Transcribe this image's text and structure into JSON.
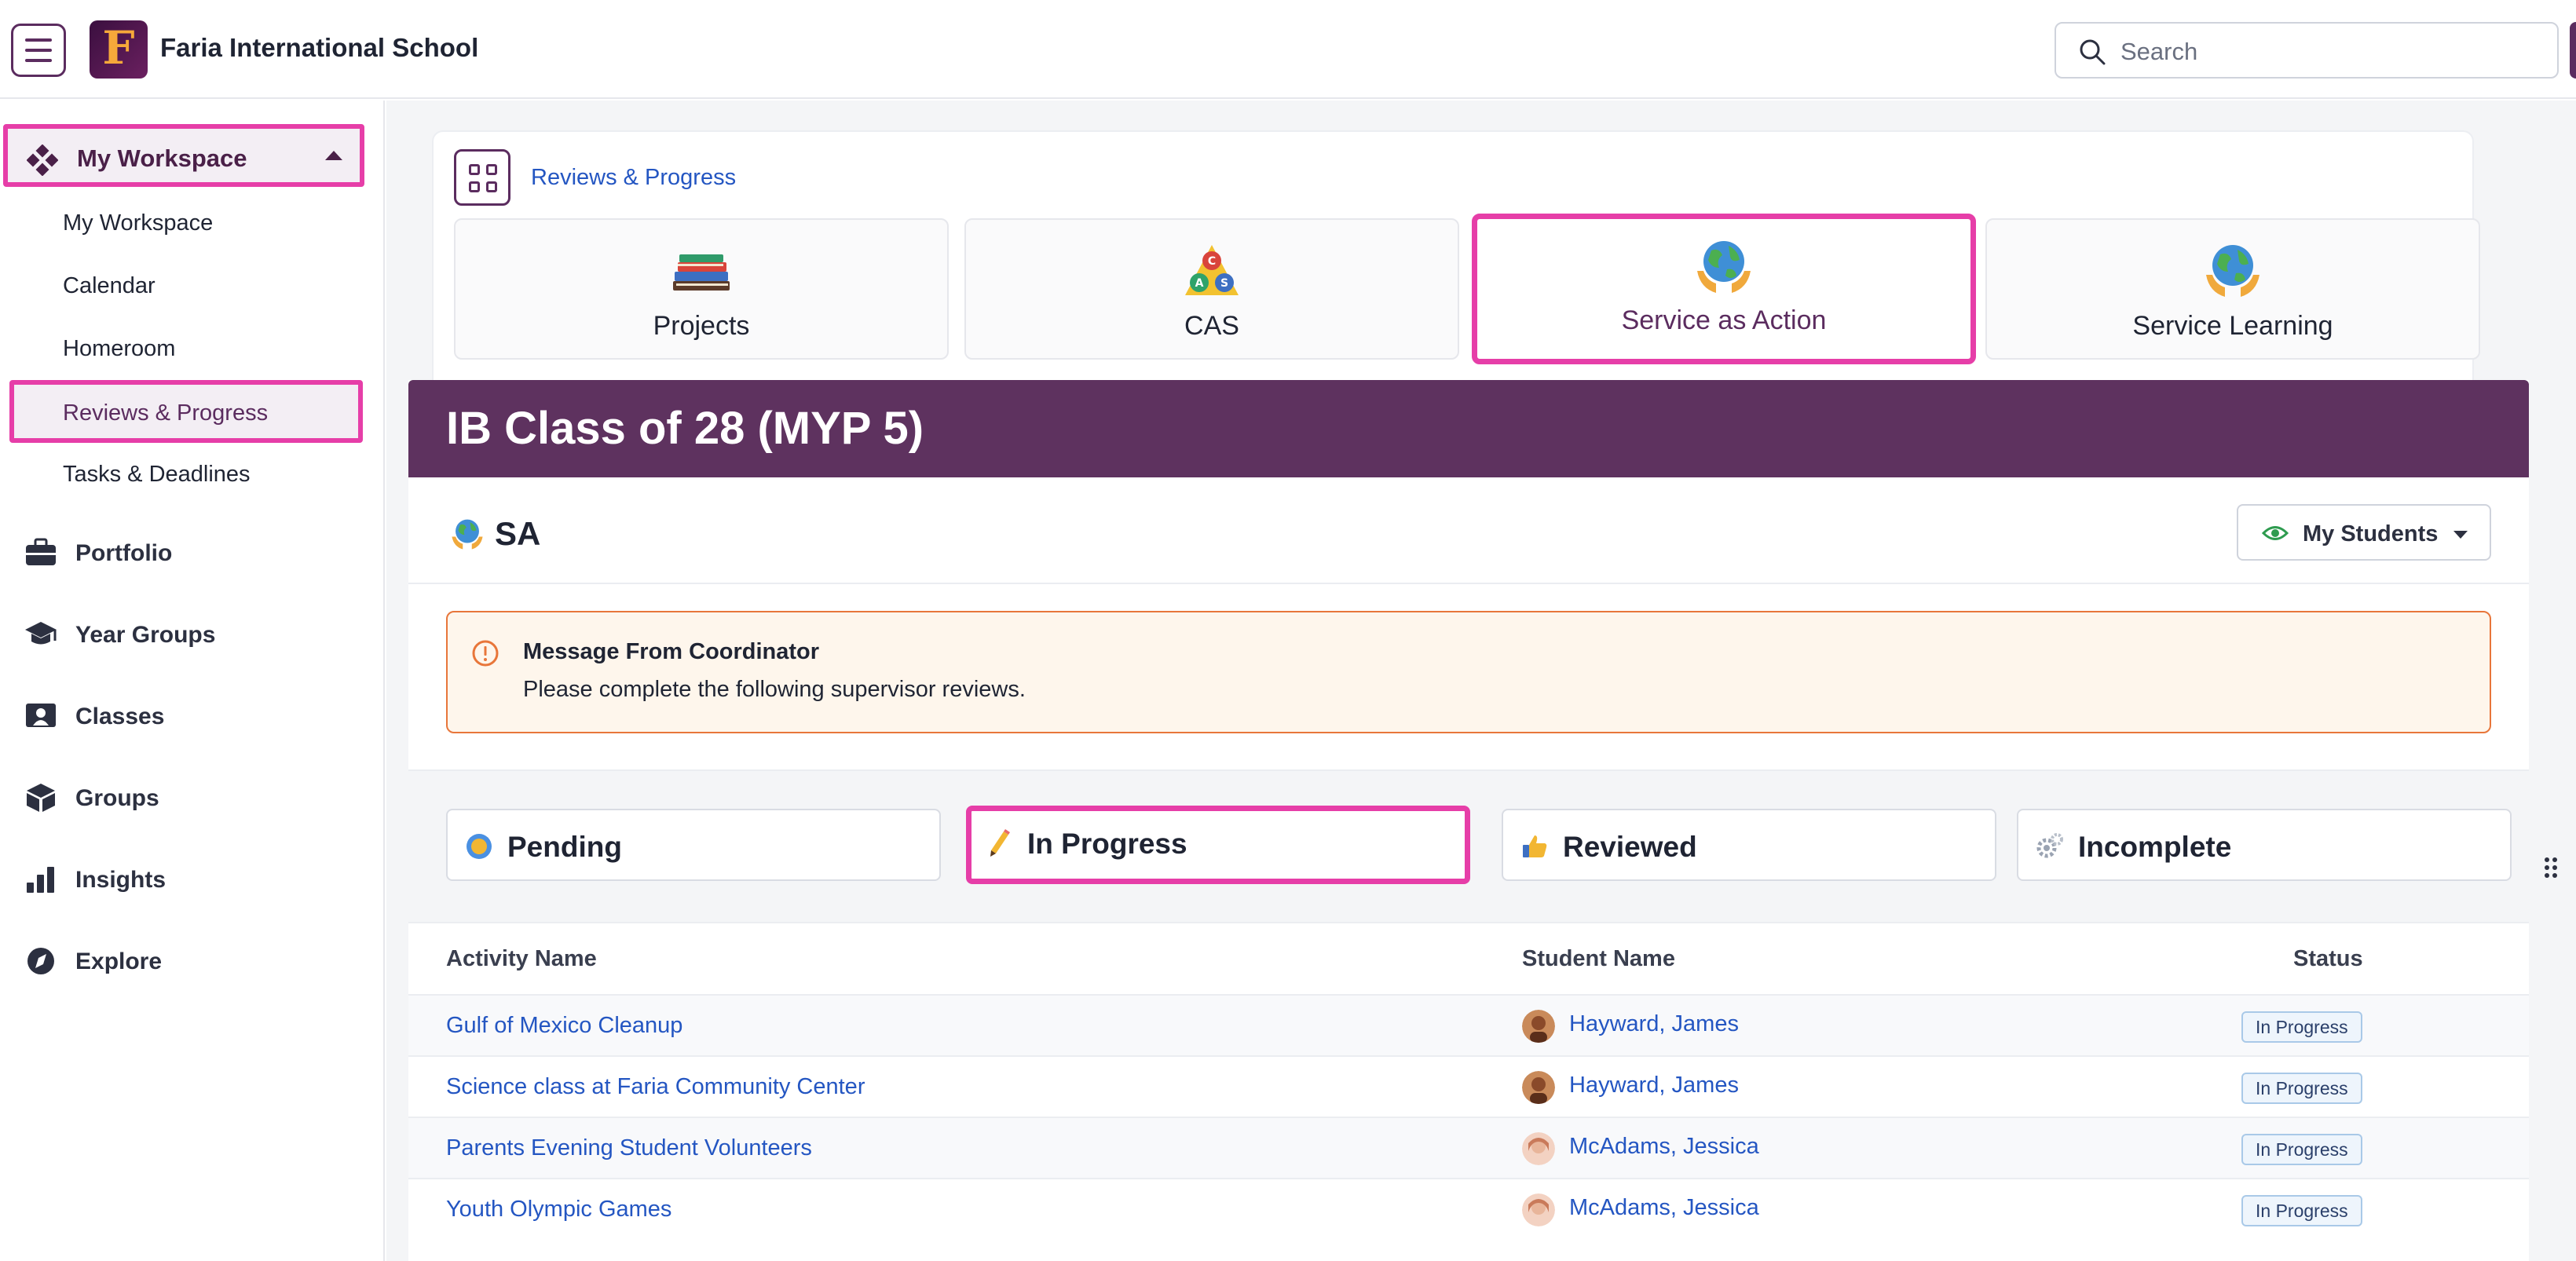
{
  "app": {
    "school_name": "Faria International School",
    "logo_letter": "F"
  },
  "search": {
    "placeholder": "Search"
  },
  "sidebar": {
    "workspace_header": "My Workspace",
    "workspace_items": [
      "My Workspace",
      "Calendar",
      "Homeroom",
      "Reviews & Progress",
      "Tasks & Deadlines"
    ],
    "active_workspace_item": "Reviews & Progress",
    "nav": [
      {
        "label": "Portfolio",
        "icon": "briefcase-icon"
      },
      {
        "label": "Year Groups",
        "icon": "graduation-cap-icon"
      },
      {
        "label": "Classes",
        "icon": "classroom-icon"
      },
      {
        "label": "Groups",
        "icon": "cube-icon"
      },
      {
        "label": "Insights",
        "icon": "bar-chart-icon"
      },
      {
        "label": "Explore",
        "icon": "compass-icon"
      }
    ]
  },
  "hub": {
    "title": "Reviews & Progress",
    "cards": [
      {
        "label": "Projects",
        "icon": "books-icon"
      },
      {
        "label": "CAS",
        "icon": "cas-triangle-icon"
      },
      {
        "label": "Service as Action",
        "icon": "globe-hands-icon"
      },
      {
        "label": "Service Learning",
        "icon": "globe-hands-icon"
      }
    ],
    "active_card": "Service as Action"
  },
  "class": {
    "title": "IB Class of 28 (MYP 5)",
    "section_label": "SA",
    "students_filter": "My Students"
  },
  "message": {
    "title": "Message From Coordinator",
    "body": "Please complete the following supervisor reviews."
  },
  "status_tabs": [
    {
      "label": "Pending",
      "icon": "pending-circle-icon"
    },
    {
      "label": "In Progress",
      "icon": "pencil-icon"
    },
    {
      "label": "Reviewed",
      "icon": "thumbs-up-icon"
    },
    {
      "label": "Incomplete",
      "icon": "gears-icon"
    }
  ],
  "active_status_tab": "In Progress",
  "table": {
    "headers": [
      "Activity Name",
      "Student Name",
      "Status"
    ],
    "rows": [
      {
        "activity": "Gulf of Mexico Cleanup",
        "student": "Hayward, James",
        "status": "In Progress"
      },
      {
        "activity": "Science class at Faria Community Center",
        "student": "Hayward, James",
        "status": "In Progress"
      },
      {
        "activity": "Parents Evening Student Volunteers",
        "student": "McAdams, Jessica",
        "status": "In Progress"
      },
      {
        "activity": "Youth Olympic Games",
        "student": "McAdams, Jessica",
        "status": "In Progress"
      }
    ]
  },
  "colors": {
    "brand_purple": "#5e325f",
    "highlight_pink": "#e63ea8",
    "link_blue": "#2456c2",
    "warning_orange": "#e8763a"
  }
}
